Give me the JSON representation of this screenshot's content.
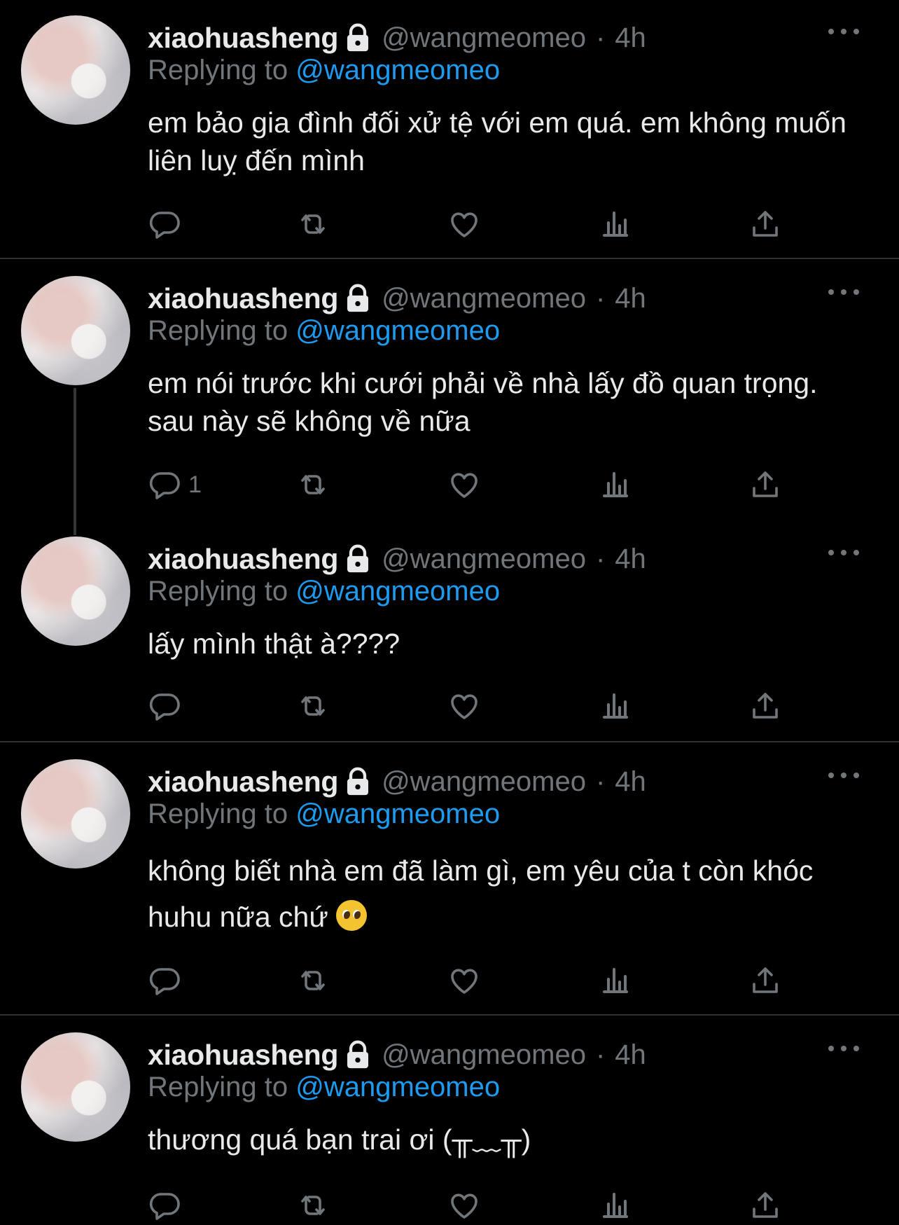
{
  "tweets": [
    {
      "display_name": "xiaohuasheng",
      "handle": "@wangmeomeo",
      "dot": "·",
      "time": "4h",
      "replying_prefix": "Replying to",
      "replying_to": "@wangmeomeo",
      "text": "em bảo gia đình đối xử tệ với em quá. em không muốn liên luỵ đến mình",
      "reply_count": ""
    },
    {
      "display_name": "xiaohuasheng",
      "handle": "@wangmeomeo",
      "dot": "·",
      "time": "4h",
      "replying_prefix": "Replying to",
      "replying_to": "@wangmeomeo",
      "text": "em nói trước khi cưới phải về nhà lấy đồ quan trọng. sau này sẽ không về nữa",
      "reply_count": "1"
    },
    {
      "display_name": "xiaohuasheng",
      "handle": "@wangmeomeo",
      "dot": "·",
      "time": "4h",
      "replying_prefix": "Replying to",
      "replying_to": "@wangmeomeo",
      "text": "lấy mình thật à????",
      "reply_count": ""
    },
    {
      "display_name": "xiaohuasheng",
      "handle": "@wangmeomeo",
      "dot": "·",
      "time": "4h",
      "replying_prefix": "Replying to",
      "replying_to": "@wangmeomeo",
      "text": "không biết nhà em đã làm gì, em yêu của t còn khóc huhu nữa chứ",
      "reply_count": ""
    },
    {
      "display_name": "xiaohuasheng",
      "handle": "@wangmeomeo",
      "dot": "·",
      "time": "4h",
      "replying_prefix": "Replying to",
      "replying_to": "@wangmeomeo",
      "text": "thương quá bạn trai ơi (╥﹏╥)",
      "reply_count": ""
    }
  ],
  "icons": {
    "lock": "lock-icon",
    "more": "more-icon",
    "reply": "reply-icon",
    "retweet": "retweet-icon",
    "like": "heart-icon",
    "views": "views-icon",
    "share": "share-icon",
    "emoji": "pleading-face-emoji"
  },
  "colors": {
    "background": "#000000",
    "text": "#e7e9ea",
    "secondary": "#71767b",
    "accent": "#1d9bf0",
    "divider": "#2f3336"
  }
}
